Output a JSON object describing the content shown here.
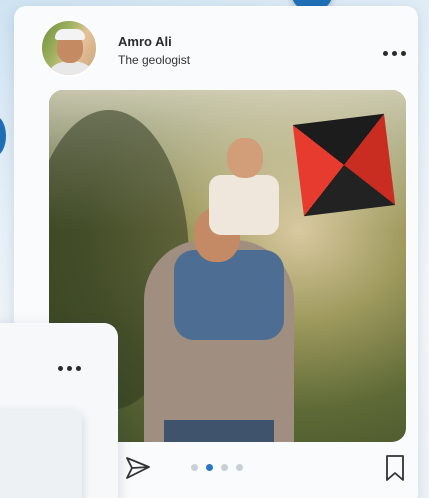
{
  "post": {
    "user_name": "Amro Ali",
    "user_subtitle": "The geologist",
    "more_icon": "more-horizontal-icon",
    "carousel": {
      "total": 4,
      "active_index": 1
    },
    "actions": {
      "share_icon": "send-icon",
      "bookmark_icon": "bookmark-icon"
    }
  },
  "colors": {
    "accent": "#2a77c5",
    "inactive_dot": "#c9cfd6",
    "card_bg": "#fafbfc"
  }
}
